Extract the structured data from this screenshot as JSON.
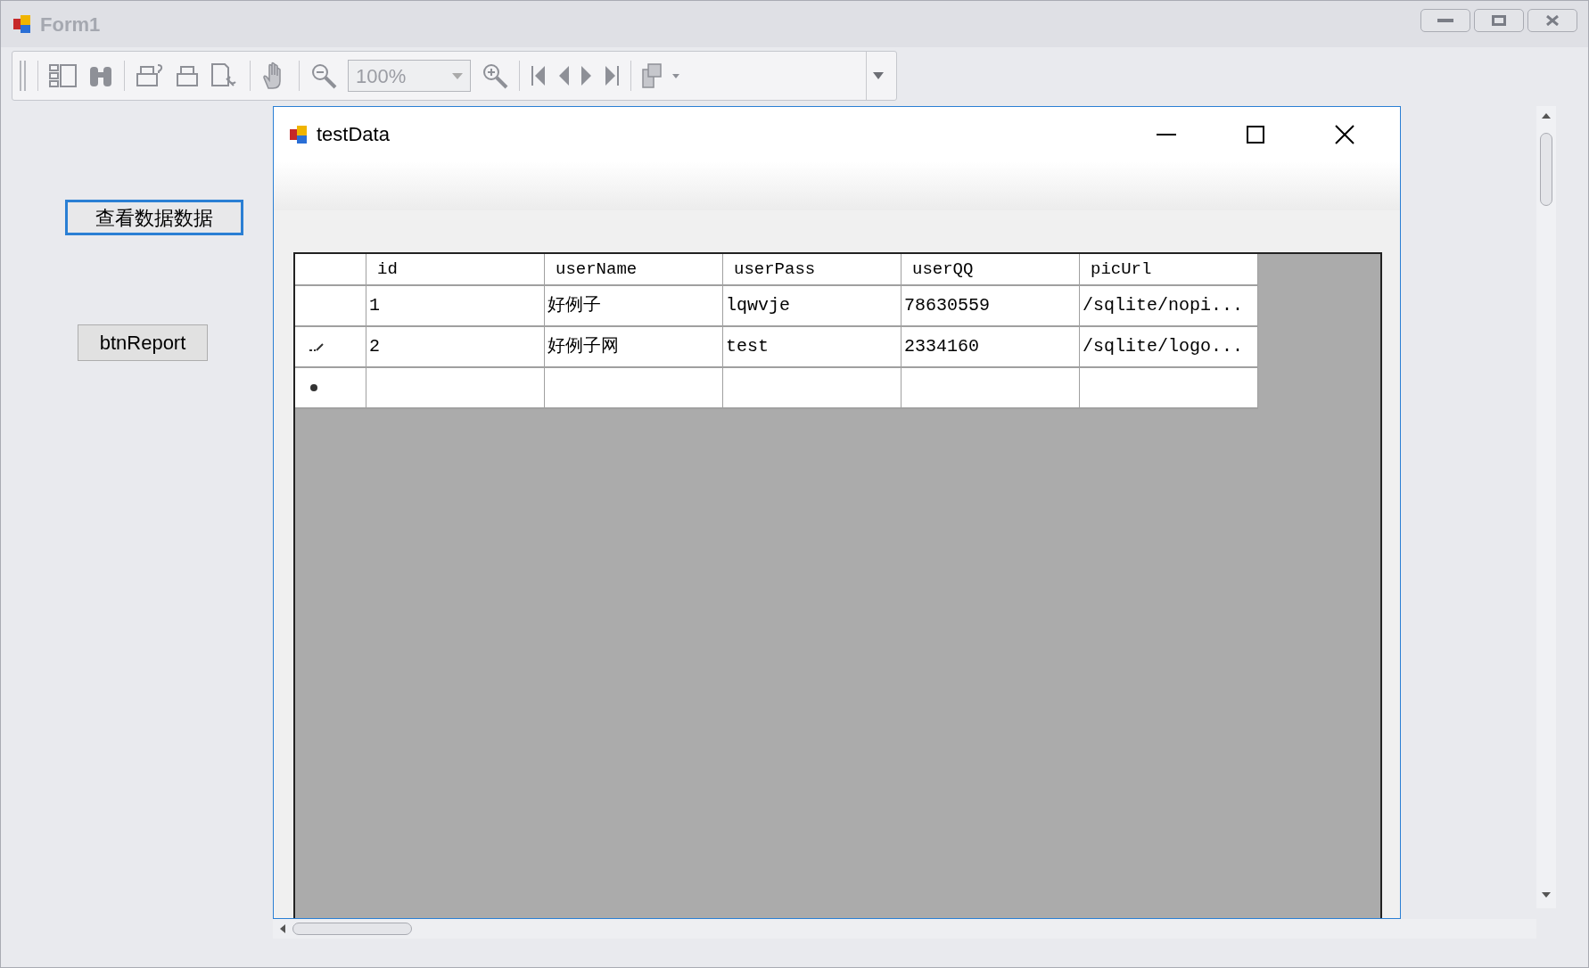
{
  "window": {
    "title": "Form1"
  },
  "toolbar": {
    "zoom": "100%"
  },
  "buttons": [
    "查看数据数据",
    "btnReport"
  ],
  "child_window": {
    "title": "testData"
  },
  "grid": {
    "columns": [
      "id",
      "userName",
      "userPass",
      "userQQ",
      "picUrl"
    ],
    "rows": [
      {
        "kind": "plain",
        "cells": [
          "1",
          "好例子",
          "lqwvje",
          "78630559",
          "/sqlite/nopi..."
        ]
      },
      {
        "kind": "editing",
        "cells": [
          "2",
          "好例子网",
          "test",
          "2334160",
          "/sqlite/logo..."
        ]
      },
      {
        "kind": "new_row"
      }
    ]
  }
}
